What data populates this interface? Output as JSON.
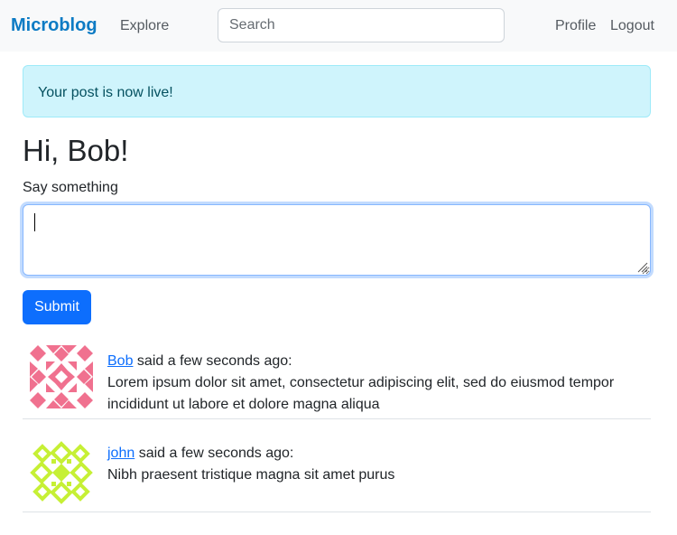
{
  "navbar": {
    "brand": "Microblog",
    "explore": "Explore",
    "search_placeholder": "Search",
    "profile": "Profile",
    "logout": "Logout"
  },
  "alert": {
    "message": "Your post is now live!"
  },
  "greeting": "Hi, Bob!",
  "form": {
    "label": "Say something",
    "textarea_value": "",
    "submit_label": "Submit"
  },
  "posts": [
    {
      "username": "Bob",
      "when": "said a few seconds ago:",
      "body": "Lorem ipsum dolor sit amet, consectetur adipiscing elit, sed do eiusmod tempor incididunt ut labore et dolore magna aliqua",
      "avatar_color": "#f0718f"
    },
    {
      "username": "john",
      "when": "said a few seconds ago:",
      "body": "Nibh praesent tristique magna sit amet purus",
      "avatar_color": "#c6f035"
    }
  ],
  "colors": {
    "brand": "#0d7bc4",
    "primary": "#0d6efd",
    "alert_bg": "#cff4fc",
    "alert_text": "#055160"
  }
}
